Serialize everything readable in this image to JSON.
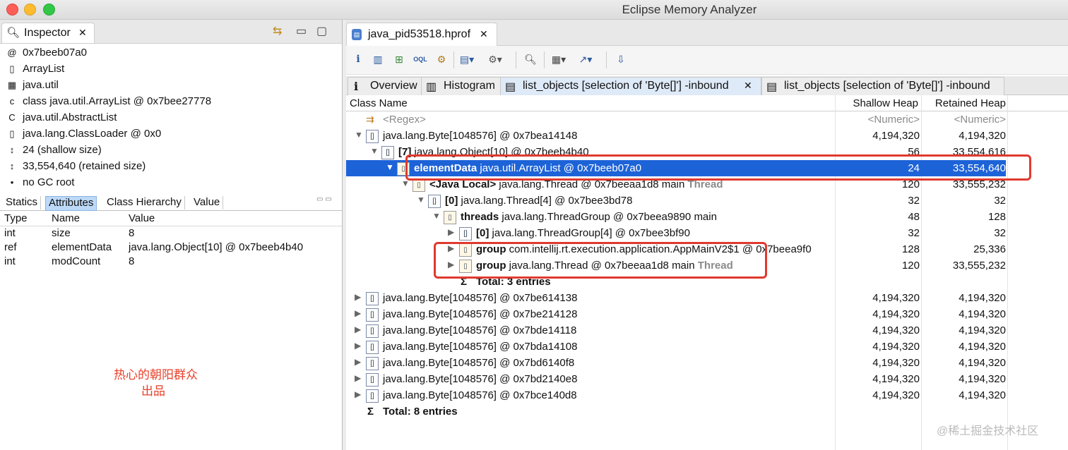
{
  "app": {
    "title": "Eclipse Memory Analyzer"
  },
  "inspector": {
    "tab_label": "Inspector",
    "rows": [
      {
        "icon": "at-icon",
        "glyph": "@",
        "text": "0x7beeb07a0"
      },
      {
        "icon": "class-icon",
        "glyph": "▯",
        "text": "ArrayList"
      },
      {
        "icon": "package-icon",
        "glyph": "▦",
        "text": "java.util"
      },
      {
        "icon": "class-file-icon",
        "glyph": "c",
        "text": "class java.util.ArrayList @ 0x7bee27778"
      },
      {
        "icon": "superclass-icon",
        "glyph": "C",
        "text": "java.util.AbstractList"
      },
      {
        "icon": "classloader-icon",
        "glyph": "▯",
        "text": "java.lang.ClassLoader @ 0x0"
      },
      {
        "icon": "shallow-size-icon",
        "glyph": "↕",
        "text": "24 (shallow size)"
      },
      {
        "icon": "retained-size-icon",
        "glyph": "↕",
        "text": "33,554,640 (retained size)"
      },
      {
        "icon": "gc-root-icon",
        "glyph": "•",
        "text": "no GC root"
      }
    ],
    "subtabs": [
      "Statics",
      "Attributes",
      "Class Hierarchy",
      "Value"
    ],
    "selected_subtab": "Attributes",
    "attr_headers": [
      "Type",
      "Name",
      "Value"
    ],
    "attributes": [
      [
        "int",
        "size",
        "8"
      ],
      [
        "ref",
        "elementData",
        "java.lang.Object[10] @ 0x7beeb4b40"
      ],
      [
        "int",
        "modCount",
        "8"
      ]
    ],
    "watermark_line1": "热心的朝阳群众",
    "watermark_line2": "出品"
  },
  "editor": {
    "tab_label": "java_pid53518.hprof",
    "result_tabs": [
      {
        "label": "Overview",
        "icon": "i"
      },
      {
        "label": "Histogram",
        "icon": "▥"
      },
      {
        "label": "list_objects [selection of 'Byte[]'] -inbound",
        "icon": "▤",
        "selected": true
      },
      {
        "label": "list_objects [selection of 'Byte[]'] -inbound",
        "icon": "▤"
      }
    ],
    "columns": [
      "Class Name",
      "Shallow Heap",
      "Retained Heap"
    ],
    "filter_row": {
      "name": "<Regex>",
      "shallow": "<Numeric>",
      "retained": "<Numeric>"
    },
    "rows": [
      {
        "indent": 0,
        "expander": "▼",
        "icon": "[]",
        "bold": "",
        "text": "java.lang.Byte[1048576] @ 0x7bea14148",
        "extra": "",
        "shallow": "4,194,320",
        "retained": "4,194,320"
      },
      {
        "indent": 1,
        "expander": "▼",
        "icon": "[]",
        "bold": "[7]",
        "text": "java.lang.Object[10] @ 0x7beeb4b40",
        "extra": "",
        "shallow": "56",
        "retained": "33,554,616"
      },
      {
        "indent": 2,
        "expander": "▼",
        "icon": "▯",
        "bold": "elementData",
        "text": "java.util.ArrayList @ 0x7beeb07a0",
        "extra": "",
        "shallow": "24",
        "retained": "33,554,640",
        "selected": true
      },
      {
        "indent": 3,
        "expander": "▼",
        "icon": "▯",
        "bold": "<Java Local>",
        "text": "java.lang.Thread @ 0x7beeaa1d8  main",
        "extra": "Thread",
        "shallow": "120",
        "retained": "33,555,232"
      },
      {
        "indent": 4,
        "expander": "▼",
        "icon": "[]",
        "bold": "[0]",
        "text": "java.lang.Thread[4] @ 0x7bee3bd78",
        "extra": "",
        "shallow": "32",
        "retained": "32"
      },
      {
        "indent": 5,
        "expander": "▼",
        "icon": "▯",
        "bold": "threads",
        "text": "java.lang.ThreadGroup @ 0x7beea9890  main",
        "extra": "",
        "shallow": "48",
        "retained": "128"
      },
      {
        "indent": 6,
        "expander": "▶",
        "icon": "[]",
        "bold": "[0]",
        "text": "java.lang.ThreadGroup[4] @ 0x7bee3bf90",
        "extra": "",
        "shallow": "32",
        "retained": "32"
      },
      {
        "indent": 6,
        "expander": "▶",
        "icon": "▯",
        "bold": "group",
        "text": "com.intellij.rt.execution.application.AppMainV2$1 @ 0x7beea9f0",
        "extra": "",
        "shallow": "128",
        "retained": "25,336"
      },
      {
        "indent": 6,
        "expander": "▶",
        "icon": "▯",
        "bold": "group",
        "text": "java.lang.Thread @ 0x7beeaa1d8  main",
        "extra": "Thread",
        "shallow": "120",
        "retained": "33,555,232"
      },
      {
        "indent": 6,
        "expander": "",
        "icon": "Σ",
        "bold": "Total: 3 entries",
        "text": "",
        "extra": "",
        "shallow": "",
        "retained": ""
      },
      {
        "indent": 0,
        "expander": "▶",
        "icon": "[]",
        "bold": "",
        "text": "java.lang.Byte[1048576] @ 0x7be614138",
        "extra": "",
        "shallow": "4,194,320",
        "retained": "4,194,320"
      },
      {
        "indent": 0,
        "expander": "▶",
        "icon": "[]",
        "bold": "",
        "text": "java.lang.Byte[1048576] @ 0x7be214128",
        "extra": "",
        "shallow": "4,194,320",
        "retained": "4,194,320"
      },
      {
        "indent": 0,
        "expander": "▶",
        "icon": "[]",
        "bold": "",
        "text": "java.lang.Byte[1048576] @ 0x7bde14118",
        "extra": "",
        "shallow": "4,194,320",
        "retained": "4,194,320"
      },
      {
        "indent": 0,
        "expander": "▶",
        "icon": "[]",
        "bold": "",
        "text": "java.lang.Byte[1048576] @ 0x7bda14108",
        "extra": "",
        "shallow": "4,194,320",
        "retained": "4,194,320"
      },
      {
        "indent": 0,
        "expander": "▶",
        "icon": "[]",
        "bold": "",
        "text": "java.lang.Byte[1048576] @ 0x7bd6140f8",
        "extra": "",
        "shallow": "4,194,320",
        "retained": "4,194,320"
      },
      {
        "indent": 0,
        "expander": "▶",
        "icon": "[]",
        "bold": "",
        "text": "java.lang.Byte[1048576] @ 0x7bd2140e8",
        "extra": "",
        "shallow": "4,194,320",
        "retained": "4,194,320"
      },
      {
        "indent": 0,
        "expander": "▶",
        "icon": "[]",
        "bold": "",
        "text": "java.lang.Byte[1048576] @ 0x7bce140d8",
        "extra": "",
        "shallow": "4,194,320",
        "retained": "4,194,320"
      },
      {
        "indent": 0,
        "expander": "",
        "icon": "Σ",
        "bold": "Total: 8 entries",
        "text": "",
        "extra": "",
        "shallow": "",
        "retained": ""
      }
    ],
    "corner_watermark": "@稀土掘金技术社区"
  },
  "colors": {
    "selection": "#1d63d8",
    "highlight_box": "#e03a2f",
    "watermark_red": "#e8402a"
  }
}
